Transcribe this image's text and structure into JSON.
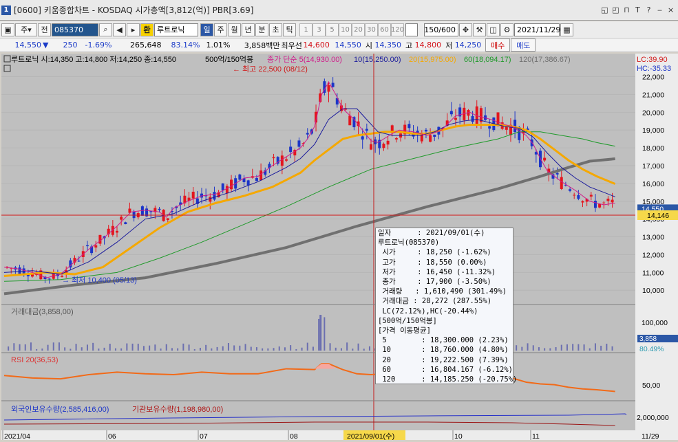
{
  "window": {
    "title": "[0600] 키움종합차트 - KOSDAQ 시가총액[3,812(억)] PBR[3.69]",
    "num": "1",
    "ctrl_icons": [
      "restore-down-icon",
      "fullscreen-icon",
      "pin-icon",
      "text-size-icon",
      "help-icon",
      "minimize-icon",
      "close-icon"
    ],
    "ctrl_glyphs": [
      "◱",
      "◰",
      "⊓",
      "T",
      "?",
      "‒",
      "×"
    ]
  },
  "toolbar": {
    "type_label": "주",
    "code": "085370",
    "stock_badge": "환",
    "stock_name": "루트로닉",
    "period_tabs": [
      "일",
      "주",
      "월",
      "년",
      "분",
      "초",
      "틱"
    ],
    "number_tabs": [
      "1",
      "3",
      "5",
      "10",
      "20",
      "30",
      "60",
      "120"
    ],
    "count": "150/600",
    "date": "2021/11/29"
  },
  "info": {
    "price": "14,550",
    "arrow": "▼",
    "change": "250",
    "pct": "-1.69%",
    "volume": "265,648",
    "vol_ratio": "83.14%",
    "turnover": "1.01%",
    "amount": "3,858백만",
    "best_label": "최우선",
    "best_ask": "14,600",
    "best_bid": "14,550",
    "open_lbl": "시",
    "open": "14,350",
    "high_lbl": "고",
    "high": "14,800",
    "low_lbl": "저",
    "low": "14,250",
    "buy": "매수",
    "sell": "매도"
  },
  "price_panel": {
    "header": "루트로닉 시:14,350 고:14,800 저:14,250 종:14,550",
    "ma_header": "500억/150억봉",
    "ma_labels": [
      "종가 단순 5(14,930.00)",
      "10(15,250.00)",
      "20(15,975.00)",
      "60(18,094.17)",
      "120(17,386.67)"
    ],
    "ma_colors": [
      "#d11a8a",
      "#1b1b9c",
      "#f5a800",
      "#1f9a2a",
      "#707070"
    ],
    "lc": "LC:39.90",
    "hc": "HC:-35.33",
    "high_note": "최고 22,500 (08/12)",
    "low_note": "최저 10,400 (05/13)",
    "ticks": [
      "22,000",
      "21,000",
      "20,000",
      "19,000",
      "18,000",
      "17,000",
      "16,000",
      "15,000",
      "14,000",
      "13,000",
      "12,000",
      "11,000",
      "10,000"
    ],
    "cur_price": "14,550",
    "cross_price": "14,146"
  },
  "volume_panel": {
    "label": "거래대금(3,858,00)",
    "tick": "100,000",
    "cur": "3,858",
    "pct": "80.49%"
  },
  "rsi_panel": {
    "label": "RSI 20(36,53)",
    "tick": "50,00"
  },
  "holding_panel": {
    "label1": "외국인보유수량(2,585,416,00)",
    "label2": "기관보유수량(1,198,980,00)",
    "tick": "2,000,000"
  },
  "x_axis": {
    "labels": [
      "2021/04",
      "06",
      "07",
      "08",
      "10",
      "11"
    ],
    "cursor_date": "2021/09/01(수)",
    "right_date": "11/29"
  },
  "tooltip": {
    "rows": [
      "일자      : 2021/09/01(수)",
      "루트로닉(085370)",
      " 시가     : 18,250 (-1.62%)",
      " 고가     : 18,550 (0.00%)",
      " 저가     : 16,450 (-11.32%)",
      " 종가     : 17,900 (-3.50%)",
      " 거래량   : 1,610,490 (301.49%)",
      " 거래대금 : 28,272 (287.55%)",
      " LC(72.12%),HC(-20.44%)",
      "[500억/150억봉]",
      "[가격 이동평균]",
      " 5        : 18,300.000 (2.23%)",
      " 10       : 18,760.000 (4.80%)",
      " 20       : 19,222.500 (7.39%)",
      " 60       : 16,804.167 (-6.12%)",
      " 120      : 14,185.250 (-20.75%)"
    ]
  },
  "chart_data": {
    "type": "line",
    "ylim": [
      9700,
      22600
    ],
    "ma5": [
      [
        0,
        11300
      ],
      [
        10,
        11200
      ],
      [
        20,
        11000
      ],
      [
        30,
        10700
      ],
      [
        40,
        10900
      ],
      [
        50,
        11600
      ],
      [
        60,
        12300
      ],
      [
        70,
        12900
      ],
      [
        80,
        13600
      ],
      [
        90,
        14400
      ],
      [
        100,
        14500
      ],
      [
        110,
        14400
      ],
      [
        115,
        14100
      ],
      [
        120,
        14600
      ],
      [
        130,
        15000
      ],
      [
        140,
        15300
      ],
      [
        150,
        15400
      ],
      [
        160,
        15800
      ],
      [
        170,
        16300
      ],
      [
        180,
        16400
      ],
      [
        190,
        17000
      ],
      [
        200,
        17500
      ],
      [
        210,
        18000
      ],
      [
        215,
        18500
      ],
      [
        220,
        19200
      ],
      [
        225,
        21000
      ],
      [
        230,
        21700
      ],
      [
        235,
        21000
      ],
      [
        240,
        20200
      ],
      [
        248,
        19600
      ],
      [
        255,
        18900
      ],
      [
        260,
        18400
      ],
      [
        265,
        18300
      ],
      [
        275,
        18800
      ],
      [
        280,
        19000
      ],
      [
        290,
        18900
      ],
      [
        300,
        18700
      ],
      [
        310,
        19000
      ],
      [
        320,
        19800
      ],
      [
        330,
        20000
      ],
      [
        335,
        19800
      ],
      [
        345,
        19600
      ],
      [
        355,
        19300
      ],
      [
        360,
        19200
      ],
      [
        370,
        18700
      ],
      [
        375,
        18200
      ],
      [
        380,
        17400
      ],
      [
        385,
        16700
      ],
      [
        395,
        16100
      ],
      [
        405,
        15600
      ],
      [
        415,
        15000
      ],
      [
        425,
        14800
      ],
      [
        433,
        14900
      ]
    ],
    "ma10": [
      [
        0,
        11000
      ],
      [
        20,
        11100
      ],
      [
        40,
        10900
      ],
      [
        60,
        11600
      ],
      [
        80,
        12700
      ],
      [
        100,
        14000
      ],
      [
        120,
        14300
      ],
      [
        140,
        15000
      ],
      [
        160,
        15500
      ],
      [
        180,
        16100
      ],
      [
        200,
        16900
      ],
      [
        210,
        17400
      ],
      [
        220,
        18200
      ],
      [
        230,
        19600
      ],
      [
        240,
        20200
      ],
      [
        250,
        20200
      ],
      [
        258,
        19500
      ],
      [
        265,
        18900
      ],
      [
        275,
        18700
      ],
      [
        285,
        18700
      ],
      [
        295,
        18700
      ],
      [
        305,
        18900
      ],
      [
        315,
        19300
      ],
      [
        325,
        19500
      ],
      [
        335,
        19600
      ],
      [
        345,
        19400
      ],
      [
        355,
        19200
      ],
      [
        365,
        19100
      ],
      [
        375,
        18600
      ],
      [
        385,
        17700
      ],
      [
        395,
        16900
      ],
      [
        405,
        16300
      ],
      [
        415,
        15800
      ],
      [
        425,
        15500
      ],
      [
        433,
        15250
      ]
    ],
    "ma20": [
      [
        0,
        10800
      ],
      [
        30,
        11000
      ],
      [
        50,
        10900
      ],
      [
        70,
        11300
      ],
      [
        90,
        12400
      ],
      [
        110,
        13500
      ],
      [
        130,
        14400
      ],
      [
        150,
        14900
      ],
      [
        170,
        15300
      ],
      [
        190,
        15800
      ],
      [
        210,
        16600
      ],
      [
        220,
        17300
      ],
      [
        230,
        17900
      ],
      [
        240,
        18500
      ],
      [
        250,
        18700
      ],
      [
        260,
        18800
      ],
      [
        270,
        18900
      ],
      [
        280,
        18900
      ],
      [
        290,
        18800
      ],
      [
        300,
        18800
      ],
      [
        310,
        19000
      ],
      [
        320,
        19200
      ],
      [
        330,
        19300
      ],
      [
        340,
        19300
      ],
      [
        350,
        19300
      ],
      [
        360,
        19200
      ],
      [
        370,
        19000
      ],
      [
        380,
        18500
      ],
      [
        390,
        17900
      ],
      [
        400,
        17300
      ],
      [
        410,
        16800
      ],
      [
        420,
        16400
      ],
      [
        433,
        15975
      ]
    ],
    "ma60": [
      [
        0,
        10500
      ],
      [
        40,
        10600
      ],
      [
        80,
        11000
      ],
      [
        110,
        11800
      ],
      [
        140,
        12700
      ],
      [
        170,
        13700
      ],
      [
        200,
        14700
      ],
      [
        230,
        15800
      ],
      [
        260,
        16800
      ],
      [
        290,
        17400
      ],
      [
        320,
        18000
      ],
      [
        350,
        18500
      ],
      [
        365,
        18900
      ],
      [
        380,
        18900
      ],
      [
        395,
        18700
      ],
      [
        410,
        18500
      ],
      [
        420,
        18300
      ],
      [
        433,
        18094
      ]
    ],
    "ma120": [
      [
        0,
        9800
      ],
      [
        50,
        10300
      ],
      [
        100,
        10700
      ],
      [
        150,
        11500
      ],
      [
        200,
        12400
      ],
      [
        250,
        13600
      ],
      [
        300,
        14700
      ],
      [
        350,
        15700
      ],
      [
        380,
        16400
      ],
      [
        400,
        16900
      ],
      [
        415,
        17250
      ],
      [
        433,
        17387
      ]
    ],
    "rsi": [
      [
        0,
        56
      ],
      [
        20,
        53
      ],
      [
        40,
        52
      ],
      [
        60,
        57
      ],
      [
        80,
        60
      ],
      [
        100,
        58
      ],
      [
        120,
        57
      ],
      [
        140,
        60
      ],
      [
        160,
        58
      ],
      [
        180,
        58
      ],
      [
        200,
        64
      ],
      [
        220,
        63
      ],
      [
        225,
        70
      ],
      [
        230,
        70
      ],
      [
        240,
        63
      ],
      [
        250,
        58
      ],
      [
        260,
        57
      ],
      [
        270,
        58
      ],
      [
        280,
        57
      ],
      [
        290,
        57
      ],
      [
        300,
        58
      ],
      [
        310,
        57
      ],
      [
        320,
        56
      ],
      [
        330,
        58
      ],
      [
        340,
        56
      ],
      [
        350,
        54
      ],
      [
        360,
        53
      ],
      [
        370,
        48
      ],
      [
        380,
        46
      ],
      [
        390,
        45
      ],
      [
        400,
        42
      ],
      [
        410,
        40
      ],
      [
        420,
        39
      ],
      [
        433,
        37
      ]
    ]
  }
}
